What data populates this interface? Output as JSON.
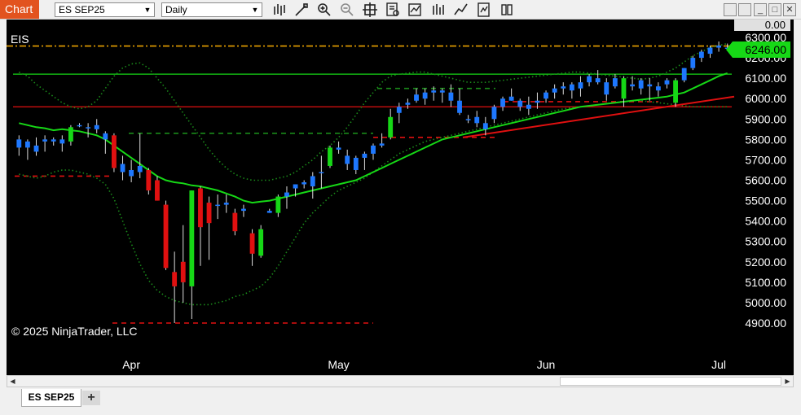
{
  "toolbar": {
    "window_label": "Chart",
    "instrument": "ES SEP25",
    "timeframe": "Daily",
    "icons": [
      "bars-type-icon",
      "drawing-tool-icon",
      "zoom-in-icon",
      "zoom-out-icon",
      "crosshair-icon",
      "data-box-icon",
      "indicators-icon",
      "strategies-icon",
      "properties-icon"
    ]
  },
  "chart": {
    "symbol_label": "EIS",
    "copyright": "© 2025 NinjaTrader, LLC",
    "last_price_label": "6246.00",
    "top_label": "0.00",
    "colors": {
      "up_candle": "#16d816",
      "down_candle": "#e01010",
      "up_blue": "#1e78ff",
      "sma": "#16d816",
      "bands": "#1a8a1a",
      "trend_red": "#e01010"
    }
  },
  "chart_data": {
    "type": "candlestick",
    "ylim": [
      4850,
      6300
    ],
    "y_ticks": [
      "6300.00",
      "6200.00",
      "6100.00",
      "6000.00",
      "5900.00",
      "5800.00",
      "5700.00",
      "5600.00",
      "5500.00",
      "5400.00",
      "5300.00",
      "5200.00",
      "5100.00",
      "5000.00",
      "4900.00"
    ],
    "x_ticks": [
      "Apr",
      "May",
      "Jun",
      "Jul"
    ],
    "candles": [
      [
        5800,
        5820,
        5720,
        5760
      ],
      [
        5760,
        5800,
        5700,
        5790
      ],
      [
        5770,
        5810,
        5720,
        5740
      ],
      [
        5790,
        5820,
        5740,
        5800
      ],
      [
        5790,
        5810,
        5770,
        5800
      ],
      [
        5800,
        5820,
        5740,
        5780
      ],
      [
        5790,
        5870,
        5770,
        5860
      ],
      [
        5870,
        5880,
        5860,
        5870
      ],
      [
        5860,
        5880,
        5810,
        5860
      ],
      [
        5870,
        5900,
        5830,
        5850
      ],
      [
        5800,
        5840,
        5730,
        5830
      ],
      [
        5820,
        5830,
        5640,
        5660
      ],
      [
        5680,
        5720,
        5600,
        5640
      ],
      [
        5650,
        5700,
        5590,
        5620
      ],
      [
        5640,
        5830,
        5610,
        5670
      ],
      [
        5650,
        5660,
        5530,
        5550
      ],
      [
        5600,
        5620,
        5500,
        5500
      ],
      [
        5480,
        5500,
        5160,
        5170
      ],
      [
        5150,
        5250,
        4900,
        5080
      ],
      [
        5200,
        5380,
        5000,
        5100
      ],
      [
        5080,
        5550,
        4920,
        5550
      ],
      [
        5560,
        5570,
        5180,
        5370
      ],
      [
        5490,
        5520,
        5210,
        5390
      ],
      [
        5480,
        5530,
        5410,
        5480
      ],
      [
        5490,
        5530,
        5440,
        5480
      ],
      [
        5440,
        5460,
        5330,
        5350
      ],
      [
        5460,
        5480,
        5420,
        5450
      ],
      [
        5340,
        5360,
        5180,
        5240
      ],
      [
        5230,
        5380,
        5220,
        5360
      ],
      [
        5440,
        5460,
        5440,
        5450
      ],
      [
        5440,
        5530,
        5420,
        5520
      ],
      [
        5520,
        5570,
        5460,
        5540
      ],
      [
        5560,
        5580,
        5520,
        5580
      ],
      [
        5580,
        5600,
        5560,
        5590
      ],
      [
        5570,
        5640,
        5510,
        5620
      ],
      [
        5640,
        5720,
        5560,
        5640
      ],
      [
        5670,
        5770,
        5660,
        5760
      ],
      [
        5760,
        5790,
        5730,
        5750
      ],
      [
        5720,
        5750,
        5650,
        5680
      ],
      [
        5650,
        5720,
        5630,
        5710
      ],
      [
        5710,
        5740,
        5650,
        5730
      ],
      [
        5730,
        5780,
        5700,
        5770
      ],
      [
        5770,
        5830,
        5760,
        5780
      ],
      [
        5810,
        5950,
        5800,
        5910
      ],
      [
        5930,
        5980,
        5880,
        5960
      ],
      [
        5970,
        6000,
        5950,
        5980
      ],
      [
        5990,
        6050,
        5980,
        6020
      ],
      [
        6030,
        6050,
        5970,
        6000
      ],
      [
        6040,
        6060,
        5990,
        6030
      ],
      [
        6030,
        6050,
        5980,
        6040
      ],
      [
        6030,
        6070,
        5960,
        5990
      ],
      [
        5990,
        6050,
        5920,
        5930
      ],
      [
        5900,
        5920,
        5880,
        5900
      ],
      [
        5910,
        5940,
        5860,
        5880
      ],
      [
        5880,
        5910,
        5820,
        5850
      ],
      [
        5900,
        5970,
        5880,
        5960
      ],
      [
        5960,
        6010,
        5940,
        6000
      ],
      [
        6010,
        6050,
        5990,
        5990
      ],
      [
        5990,
        6000,
        5940,
        5960
      ],
      [
        5950,
        6010,
        5920,
        5970
      ],
      [
        5980,
        6030,
        5950,
        5990
      ],
      [
        6000,
        6040,
        5980,
        6030
      ],
      [
        6030,
        6070,
        6000,
        6050
      ],
      [
        6060,
        6080,
        6020,
        6050
      ],
      [
        6040,
        6080,
        6000,
        6070
      ],
      [
        6050,
        6110,
        6010,
        6080
      ],
      [
        6080,
        6120,
        6060,
        6110
      ],
      [
        6100,
        6140,
        6070,
        6080
      ],
      [
        6020,
        6100,
        5990,
        6080
      ],
      [
        6100,
        6120,
        6050,
        6060
      ],
      [
        6000,
        6110,
        5960,
        6100
      ],
      [
        6060,
        6110,
        6040,
        6070
      ],
      [
        6050,
        6100,
        6020,
        6090
      ],
      [
        6070,
        6100,
        5990,
        6060
      ],
      [
        6040,
        6080,
        6010,
        6060
      ],
      [
        6070,
        6100,
        6050,
        6090
      ],
      [
        5980,
        6100,
        5960,
        6090
      ],
      [
        6090,
        6150,
        6080,
        6150
      ],
      [
        6150,
        6210,
        6140,
        6200
      ],
      [
        6200,
        6240,
        6180,
        6230
      ],
      [
        6220,
        6260,
        6200,
        6250
      ],
      [
        6250,
        6280,
        6230,
        6260
      ],
      [
        6250,
        6270,
        6240,
        6250
      ]
    ],
    "sma": [
      5880,
      5870,
      5860,
      5855,
      5845,
      5850,
      5845,
      5840,
      5830,
      5820,
      5800,
      5770,
      5740,
      5710,
      5680,
      5650,
      5620,
      5600,
      5590,
      5585,
      5575,
      5570,
      5560,
      5550,
      5535,
      5520,
      5500,
      5490,
      5495,
      5500,
      5510,
      5520,
      5530,
      5540,
      5550,
      5560,
      5570,
      5580,
      5590,
      5600,
      5620,
      5640,
      5660,
      5680,
      5700,
      5720,
      5740,
      5760,
      5780,
      5800,
      5810,
      5820,
      5830,
      5840,
      5850,
      5860,
      5870,
      5880,
      5890,
      5900,
      5910,
      5920,
      5930,
      5940,
      5950,
      5960,
      5965,
      5970,
      5975,
      5980,
      5985,
      5990,
      5995,
      6000,
      6005,
      6010,
      6020,
      6030,
      6050,
      6070,
      6090,
      6110,
      6125
    ],
    "upper_band": [
      6130,
      6110,
      6070,
      6040,
      6010,
      5980,
      5960,
      5950,
      5960,
      5990,
      6050,
      6110,
      6150,
      6170,
      6175,
      6150,
      6100,
      6050,
      5990,
      5930,
      5870,
      5810,
      5750,
      5700,
      5660,
      5630,
      5610,
      5600,
      5600,
      5600,
      5610,
      5620,
      5640,
      5670,
      5700,
      5740,
      5770,
      5810,
      5860,
      5920,
      5980,
      6030,
      6080,
      6110,
      6120,
      6125,
      6130,
      6130,
      6120,
      6110,
      6100,
      6090,
      6080,
      6080,
      6080,
      6085,
      6090,
      6095,
      6100,
      6105,
      6110,
      6115,
      6120,
      6125,
      6130,
      6130,
      6125,
      6120,
      6115,
      6110,
      6105,
      6100,
      6095,
      6100,
      6110,
      6130,
      6150,
      6180,
      6210,
      6230,
      6250,
      6260,
      6270
    ],
    "lower_band": [
      5630,
      5620,
      5610,
      5620,
      5640,
      5650,
      5650,
      5640,
      5630,
      5610,
      5580,
      5510,
      5400,
      5290,
      5190,
      5110,
      5060,
      5030,
      5010,
      5000,
      4990,
      4990,
      4990,
      5000,
      5010,
      5030,
      5040,
      5060,
      5080,
      5120,
      5180,
      5250,
      5320,
      5390,
      5440,
      5480,
      5520,
      5550,
      5570,
      5590,
      5610,
      5640,
      5670,
      5700,
      5730,
      5750,
      5770,
      5790,
      5800,
      5810,
      5820,
      5830,
      5840,
      5850,
      5860,
      5870,
      5880,
      5890,
      5900,
      5910,
      5920,
      5930,
      5940,
      5950,
      5955,
      5960,
      5965,
      5970,
      5975,
      5980,
      5985,
      5990,
      5990,
      5985,
      5980,
      5975,
      5970,
      5965,
      5960,
      5960,
      5960,
      5960,
      5960
    ],
    "levels": [
      {
        "price": 6120,
        "style": "solid",
        "color": "#16d816"
      },
      {
        "price": 5960,
        "style": "solid",
        "color": "#e01010"
      },
      {
        "price": 6258,
        "style": "dash-dot",
        "color": "#e8a000"
      },
      {
        "price": 5830,
        "style": "dashed",
        "color": "#1a8a1a"
      },
      {
        "price": 5620,
        "style": "dashed",
        "color": "#e01010"
      },
      {
        "price": 4900,
        "style": "dashed",
        "color": "#e01010"
      },
      {
        "price": 5810,
        "style": "dashed",
        "color": "#e01010"
      },
      {
        "price": 6050,
        "style": "dashed",
        "color": "#1a8a1a"
      },
      {
        "price": 5985,
        "style": "dashed",
        "color": "#e01010"
      }
    ],
    "trendline": {
      "from": 5810,
      "to": 6010,
      "color": "#e01010"
    }
  },
  "scroll": {
    "left_arrow": "◀",
    "right_arrow": "▶"
  },
  "tabs": {
    "active": "ES SEP25",
    "add": "+"
  }
}
